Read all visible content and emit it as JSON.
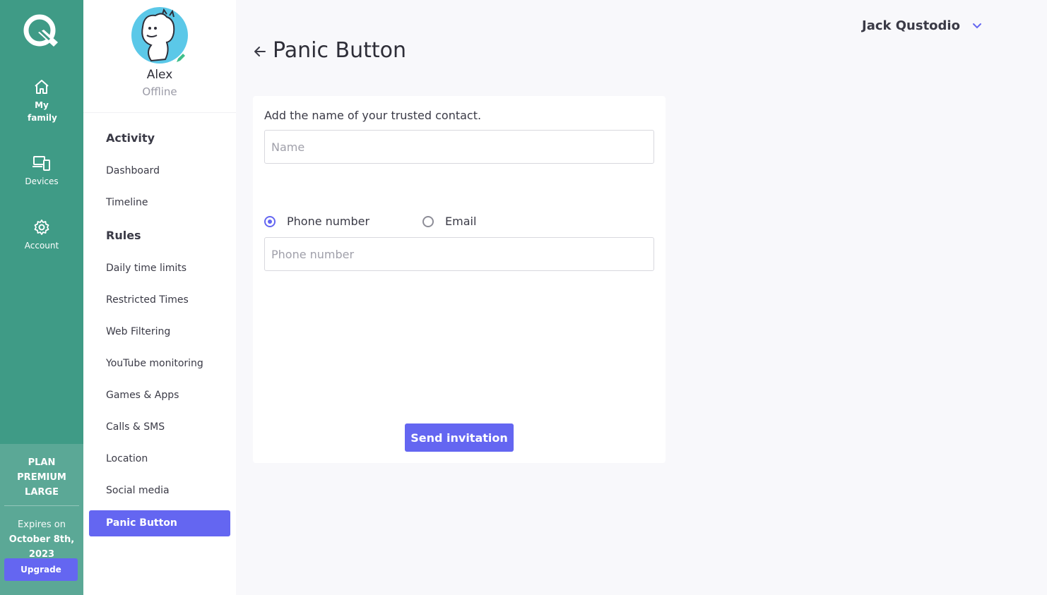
{
  "rail": {
    "logo_icon": "qustodio-logo-icon",
    "nav": [
      {
        "label": "My family",
        "icon": "home-icon",
        "active": true
      },
      {
        "label": "Devices",
        "icon": "devices-icon"
      },
      {
        "label": "Account",
        "icon": "gear-icon"
      }
    ],
    "plan": {
      "name": "PLAN PREMIUM LARGE",
      "expires_label": "Expires on",
      "expires_date": "October 8th, 2023",
      "upgrade_label": "Upgrade"
    }
  },
  "profile": {
    "name": "Alex",
    "status": "Offline",
    "avatar_icon": "hippo-avatar-icon",
    "edit_icon": "pencil-icon"
  },
  "sidebar": {
    "activity_title": "Activity",
    "activity_items": [
      "Dashboard",
      "Timeline"
    ],
    "rules_title": "Rules",
    "rules_items": [
      "Daily time limits",
      "Restricted Times",
      "Web Filtering",
      "YouTube monitoring",
      "Games & Apps",
      "Calls & SMS",
      "Location",
      "Social media"
    ],
    "active_item": "Panic Button"
  },
  "header": {
    "user_name": "Jack Qustodio",
    "user_menu_icon": "chevron-down-icon"
  },
  "page": {
    "back_icon": "arrow-left-icon",
    "title": "Panic Button"
  },
  "form": {
    "contact_label": "Add the name of your trusted contact.",
    "name_placeholder": "Name",
    "name_value": "",
    "radio_phone_label": "Phone number",
    "radio_email_label": "Email",
    "selected_method": "phone",
    "phone_placeholder": "Phone number",
    "phone_value": "",
    "send_label": "Send invitation"
  },
  "colors": {
    "rail": "#3f9b86",
    "plan_panel": "#5ba896",
    "accent": "#6466f1",
    "background": "#f8f8fb"
  }
}
